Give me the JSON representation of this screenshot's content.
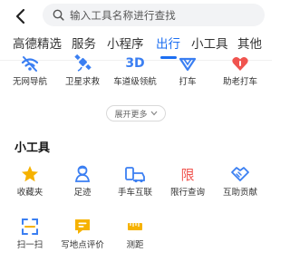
{
  "search": {
    "placeholder": "输入工具名称进行查找"
  },
  "tabs": [
    {
      "label": "高德精选"
    },
    {
      "label": "服务"
    },
    {
      "label": "小程序"
    },
    {
      "label": "出行"
    },
    {
      "label": "小工具"
    },
    {
      "label": "其他"
    }
  ],
  "active_tab": "出行",
  "travel_items": [
    {
      "label": "无网导航",
      "icon": "wifi-off-icon"
    },
    {
      "label": "卫星求救",
      "icon": "satellite-icon"
    },
    {
      "label": "车道级领航",
      "icon": "3d-icon",
      "icon_text": "3D"
    },
    {
      "label": "打车",
      "icon": "taxi-arrow-icon"
    },
    {
      "label": "助老打车",
      "icon": "heart-icon"
    }
  ],
  "expand_label": "展开更多",
  "tools_section": {
    "title": "小工具",
    "items": [
      {
        "label": "收藏夹",
        "icon": "star-icon"
      },
      {
        "label": "足迹",
        "icon": "footprint-icon"
      },
      {
        "label": "手车互联",
        "icon": "car-connect-icon"
      },
      {
        "label": "限行查询",
        "icon": "restriction-icon",
        "icon_text": "限"
      },
      {
        "label": "互助贡献",
        "icon": "handshake-icon"
      },
      {
        "label": "扫一扫",
        "icon": "scan-icon"
      },
      {
        "label": "写地点评价",
        "icon": "review-icon"
      },
      {
        "label": "测距",
        "icon": "ruler-icon"
      }
    ]
  },
  "colors": {
    "accent": "#1d6ff2",
    "icon_blue": "#3b7ff2",
    "icon_red": "#f0544f",
    "icon_yellow": "#f6b200"
  }
}
